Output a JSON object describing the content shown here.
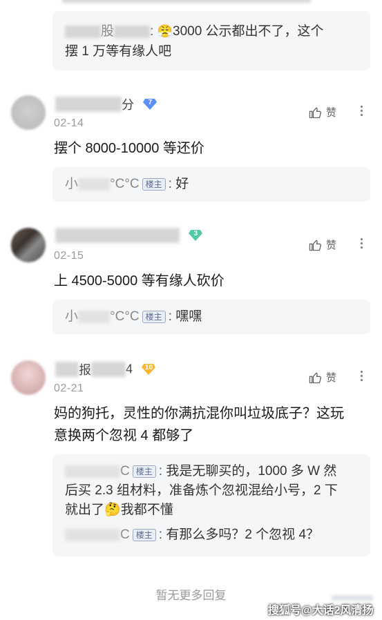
{
  "top_reply": {
    "name_suffix_1": "股",
    "emoji": "😤",
    "text_line1": "3000 公示都出不了，这个",
    "text_line2_name": "摆 1 万等有缘人吧"
  },
  "comments": [
    {
      "username_suffix": "分",
      "level": "7",
      "date": "02-14",
      "like_label": "赞",
      "text": "摆个 8000-10000 等还价",
      "reply": {
        "name_prefix": "小",
        "name_suffix": "°C°C",
        "owner_tag": "楼主",
        "text": "好"
      }
    },
    {
      "username_suffix": "",
      "level": "3",
      "date": "02-15",
      "like_label": "赞",
      "text": "上 4500-5000 等有缘人砍价",
      "reply": {
        "name_prefix": "小",
        "name_suffix": "°C°C",
        "owner_tag": "楼主",
        "text": "嘿嘿"
      }
    },
    {
      "username_prefix": "报",
      "username_suffix": "4",
      "level": "10",
      "date": "02-21",
      "like_label": "赞",
      "text_line1": "妈的狗托，灵性的你满抗混你叫垃圾底子？这玩",
      "text_line2": "意换两个忽视 4 都够了",
      "replies": [
        {
          "name_suffix": "C",
          "owner_tag": "楼主",
          "text_line1": "我是无聊买的，1000 多 W 然",
          "text_line2": "后买 2.3 组材料，准备炼个忽视混给小号，2 下",
          "text_line3": "就出了",
          "emoji": "🤔",
          "text_line3_tail": "我都不懂"
        },
        {
          "name_suffix": "C",
          "owner_tag": "楼主",
          "text": "有那么多吗？2 个忽视 4？"
        }
      ]
    }
  ],
  "footer": {
    "no_more": "暂无更多回复"
  },
  "watermark": "搜狐号@大话2风清扬",
  "colors": {
    "badge_blue": "#5b8ff9",
    "badge_green": "#52c8a4",
    "badge_gold": "#f5b82e"
  }
}
